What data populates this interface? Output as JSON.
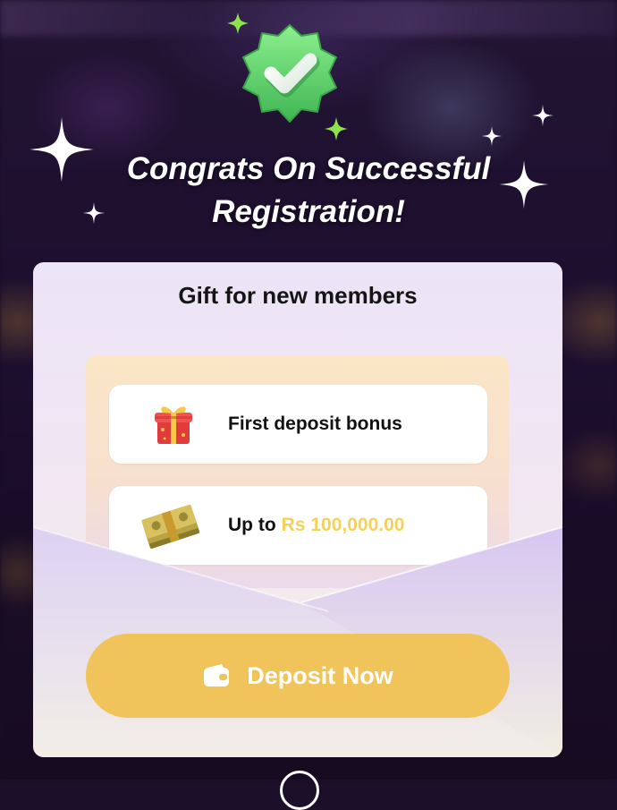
{
  "header": {
    "headline_line1": "Congrats On Successful",
    "headline_line2": "Registration!",
    "badge_icon": "check-badge-icon"
  },
  "card": {
    "title": "Gift for new members",
    "items": [
      {
        "icon": "gift-box-icon",
        "label": "First deposit bonus"
      },
      {
        "icon": "money-stack-icon",
        "label_prefix": "Up to",
        "amount": "Rs 100,000.00"
      }
    ],
    "deposit_button": {
      "icon": "wallet-icon",
      "label": "Deposit Now"
    }
  },
  "colors": {
    "accent": "#f0c45a",
    "amount": "#f4d15a",
    "badge_green": "#6fe07a"
  }
}
